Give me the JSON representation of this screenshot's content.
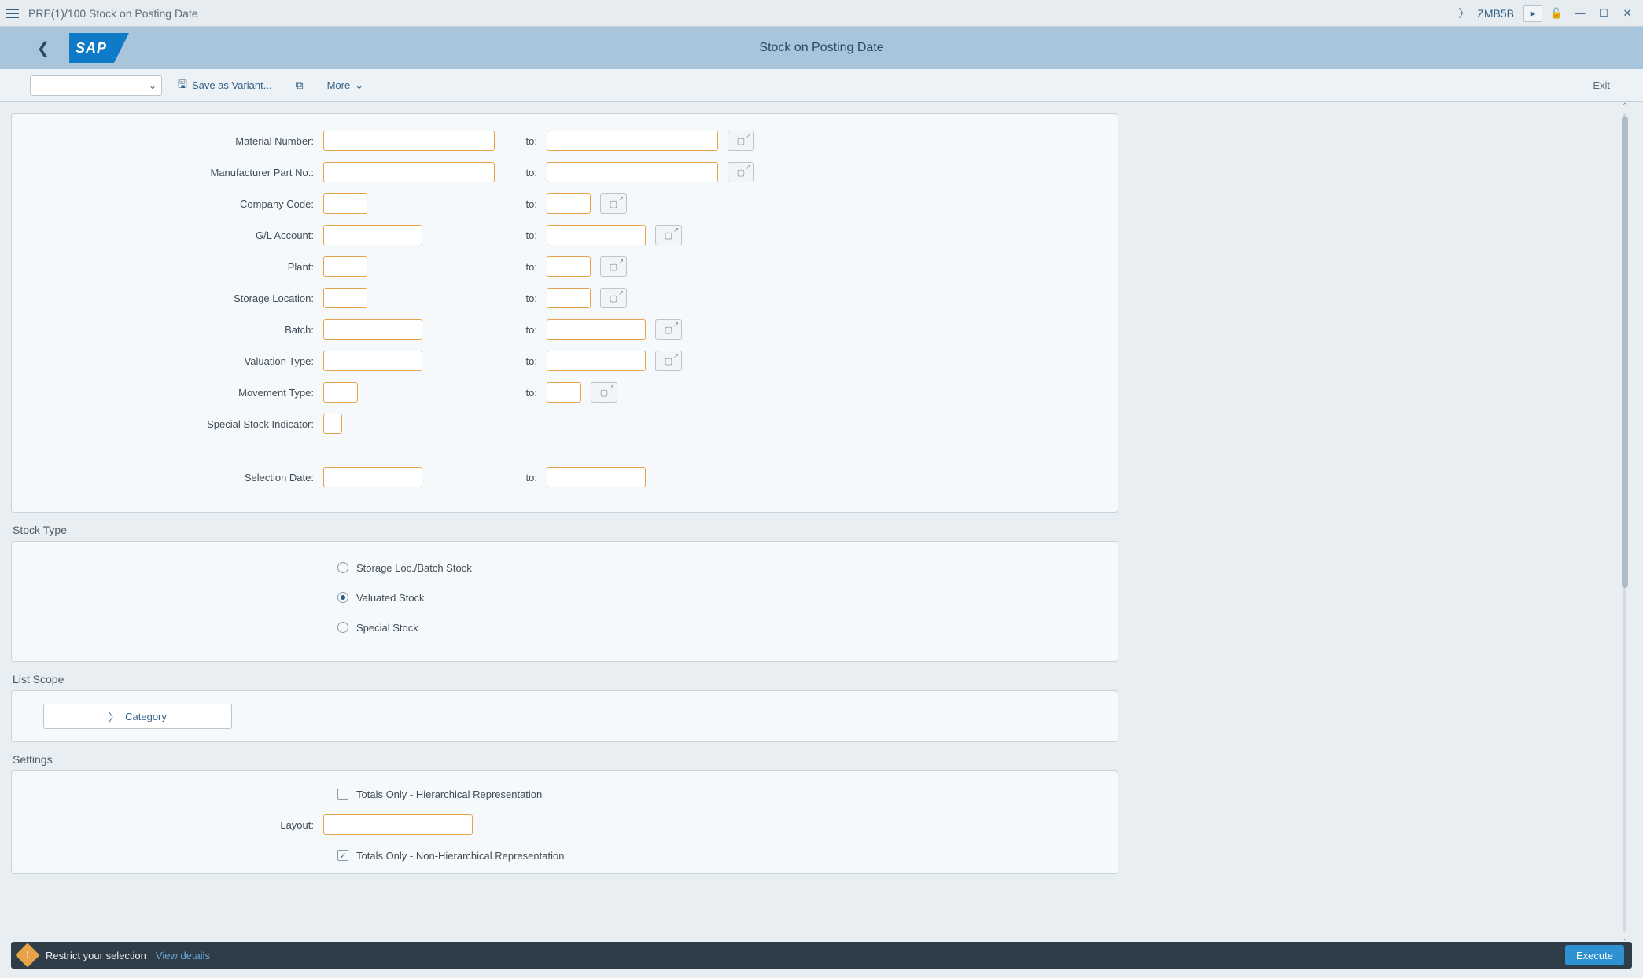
{
  "title_bar": {
    "text": "PRE(1)/100 Stock on Posting Date",
    "tcode": "ZMB5B"
  },
  "header": {
    "logo_text": "SAP",
    "title": "Stock on Posting Date"
  },
  "toolbar": {
    "save_variant": "Save as Variant...",
    "more": "More",
    "exit": "Exit"
  },
  "selection": {
    "to": "to:",
    "rows": [
      {
        "label": "Material Number:",
        "from_w": "w-lg",
        "to_w": "w-lg",
        "to_after": "after-lg",
        "has_to": true,
        "has_multi": true
      },
      {
        "label": "Manufacturer Part No.:",
        "from_w": "w-lg",
        "to_w": "w-lg",
        "to_after": "after-lg",
        "has_to": true,
        "has_multi": true
      },
      {
        "label": "Company Code:",
        "from_w": "w-sm",
        "to_w": "w-sm",
        "to_after": "after-sm",
        "has_to": true,
        "has_multi": true
      },
      {
        "label": "G/L Account:",
        "from_w": "w-md",
        "to_w": "w-md",
        "to_after": "after-md",
        "has_to": true,
        "has_multi": true
      },
      {
        "label": "Plant:",
        "from_w": "w-sm",
        "to_w": "w-sm",
        "to_after": "after-sm",
        "has_to": true,
        "has_multi": true
      },
      {
        "label": "Storage Location:",
        "from_w": "w-sm",
        "to_w": "w-sm",
        "to_after": "after-sm",
        "has_to": true,
        "has_multi": true
      },
      {
        "label": "Batch:",
        "from_w": "w-md",
        "to_w": "w-md",
        "to_after": "after-md",
        "has_to": true,
        "has_multi": true
      },
      {
        "label": "Valuation Type:",
        "from_w": "w-md",
        "to_w": "w-md",
        "to_after": "after-md",
        "has_to": true,
        "has_multi": true
      },
      {
        "label": "Movement Type:",
        "from_w": "w-xs",
        "to_w": "w-xs",
        "to_after": "after-xs",
        "has_to": true,
        "has_multi": true
      },
      {
        "label": "Special Stock Indicator:",
        "from_w": "w-xxs",
        "has_to": false,
        "has_multi": false
      }
    ],
    "selection_date": {
      "label": "Selection Date:"
    }
  },
  "stock_type": {
    "title": "Stock Type",
    "options": [
      {
        "label": "Storage Loc./Batch Stock",
        "checked": false
      },
      {
        "label": "Valuated Stock",
        "checked": true
      },
      {
        "label": "Special Stock",
        "checked": false
      }
    ]
  },
  "list_scope": {
    "title": "List Scope",
    "category": "Category"
  },
  "settings": {
    "title": "Settings",
    "totals_hier": "Totals Only - Hierarchical Representation",
    "layout_label": "Layout:",
    "totals_nonhier": "Totals Only - Non-Hierarchical Representation"
  },
  "status": {
    "message": "Restrict your selection",
    "link": "View details",
    "execute": "Execute"
  }
}
